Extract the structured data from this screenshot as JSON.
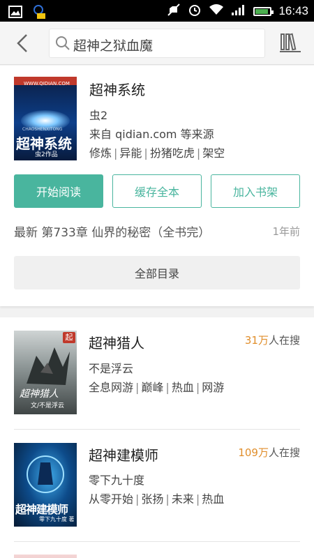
{
  "status_bar": {
    "time": "16:43",
    "battery_level": 0.9
  },
  "search": {
    "query": "超神之狱血魔"
  },
  "main_book": {
    "cover": {
      "site": "WWW.QIDIAN.COM",
      "pinyin": "CHAOSHENXITONG",
      "title": "超神系统",
      "subtitle": "虫2作品"
    },
    "title": "超神系统",
    "author": "虫2",
    "source": "来自 qidian.com 等来源",
    "tags": [
      "修炼",
      "异能",
      "扮猪吃虎",
      "架空"
    ],
    "buttons": {
      "read": "开始阅读",
      "cache": "缓存全本",
      "add": "加入书架"
    },
    "latest_chapter": "最新 第733章 仙界的秘密（全书完）",
    "latest_time": "1年前",
    "toc": "全部目录"
  },
  "results": [
    {
      "title": "超神猎人",
      "author": "不是浮云",
      "tags": [
        "全息网游",
        "巅峰",
        "热血",
        "网游"
      ],
      "count_num": "31万",
      "count_suffix": "人在搜",
      "cover": {
        "corner": "起",
        "title": "超神猎人",
        "author": "文/不是浮云"
      }
    },
    {
      "title": "超神建模师",
      "author": "零下九十度",
      "tags": [
        "从零开始",
        "张扬",
        "未来",
        "热血"
      ],
      "count_num": "109万",
      "count_suffix": "人在搜",
      "cover": {
        "title": "超神建模师",
        "author": "零下九十度 著"
      }
    }
  ]
}
